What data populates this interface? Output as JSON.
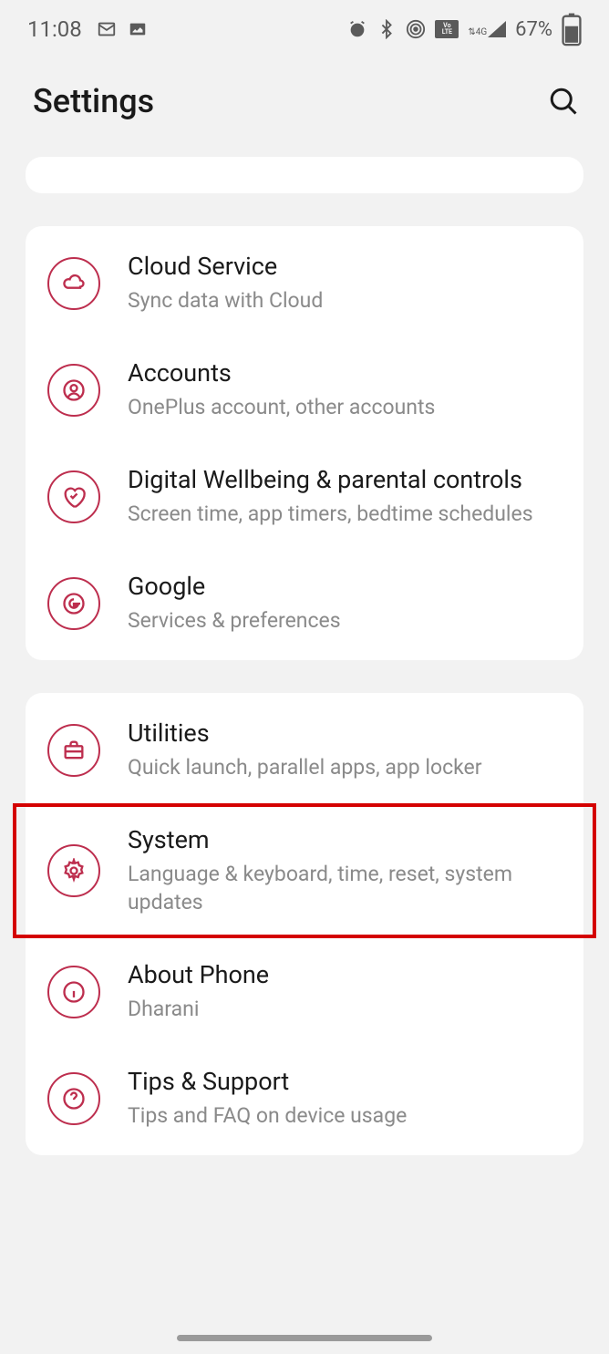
{
  "status": {
    "time": "11:08",
    "battery": "67%",
    "network_label": "4G",
    "volte_label": "VoLTE"
  },
  "header": {
    "title": "Settings"
  },
  "accent_color": "#bd2e4e",
  "groups": [
    {
      "items": [
        {
          "title": "Cloud Service",
          "subtitle": "Sync data with Cloud",
          "icon": "cloud"
        },
        {
          "title": "Accounts",
          "subtitle": "OnePlus account, other accounts",
          "icon": "person"
        },
        {
          "title": "Digital Wellbeing & parental controls",
          "subtitle": "Screen time, app timers, bedtime schedules",
          "icon": "heart"
        },
        {
          "title": "Google",
          "subtitle": "Services & preferences",
          "icon": "google"
        }
      ]
    },
    {
      "items": [
        {
          "title": "Utilities",
          "subtitle": "Quick launch, parallel apps, app locker",
          "icon": "briefcase"
        },
        {
          "title": "System",
          "subtitle": "Language & keyboard, time, reset, system updates",
          "icon": "gear",
          "highlighted": true
        },
        {
          "title": "About Phone",
          "subtitle": "Dharani",
          "icon": "info"
        },
        {
          "title": "Tips & Support",
          "subtitle": "Tips and FAQ on device usage",
          "icon": "help"
        }
      ]
    }
  ]
}
